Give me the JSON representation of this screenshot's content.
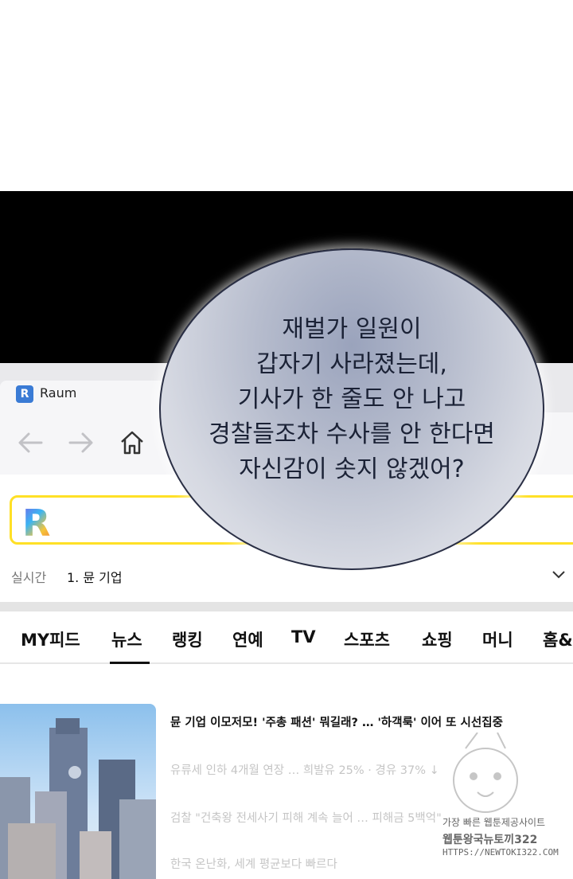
{
  "browser": {
    "tab_title": "Raum",
    "favicon_letter": "R"
  },
  "search": {
    "logo": "R"
  },
  "realtime": {
    "label": "실시간",
    "item": "1. 뮨 기업"
  },
  "nav": {
    "items": [
      "MY피드",
      "뉴스",
      "랭킹",
      "연예",
      "TV",
      "스포츠",
      "쇼핑",
      "머니",
      "홈&"
    ]
  },
  "news": {
    "headline": "뮨 기업 이모저모! '주총 패션' 뭐길래? … '하객룩' 이어 또 시선집중",
    "faded": [
      "유류세 인하 4개월 연장 … 희발유 25% · 경유 37% ↓",
      "검찰 \"건축왕 전세사기 피해 계속 늘어 … 피해금 5백억\"",
      "한국 온난화, 세계 평균보다 빠르다"
    ]
  },
  "bubble": {
    "lines": [
      "재벌가 일원이",
      "갑자기 사라졌는데,",
      "기사가 한 줄도 안 나고",
      "경찰들조차 수사를 안 한다면",
      "자신감이 솟지 않겠어?"
    ]
  },
  "watermark": {
    "line1": "가장 빠른 웹툰제공사이트",
    "line2": "웹툰왕국뉴토끼322",
    "line3": "HTTPS://NEWTOKI322.COM"
  },
  "colors": {
    "accent_yellow": "#ffe026",
    "bubble_outline": "#2a2f45",
    "favicon_blue": "#3a7bd5"
  }
}
